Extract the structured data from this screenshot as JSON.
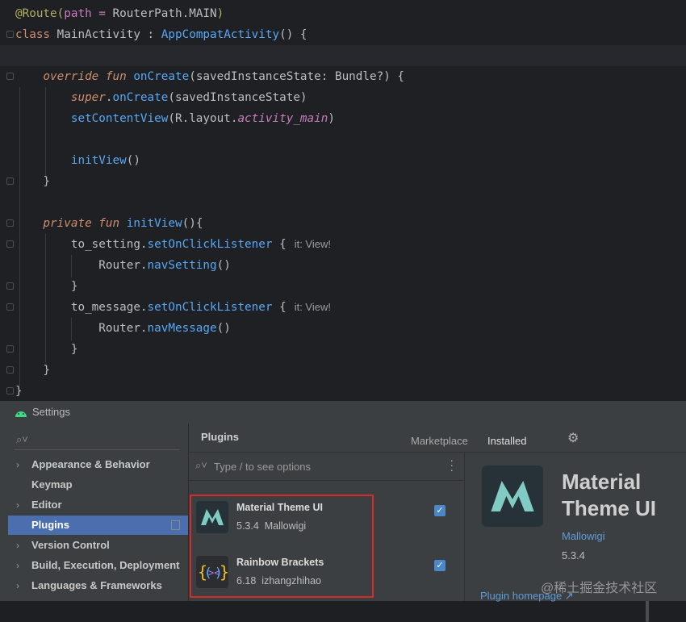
{
  "editor": {
    "lines": [
      {
        "tokens": [
          {
            "t": "@Route(",
            "c": "ann"
          },
          {
            "t": "path = ",
            "c": "str"
          },
          {
            "t": "RouterPath.",
            "c": "cls"
          },
          {
            "t": "MAIN",
            "c": "cls"
          },
          {
            "t": ")",
            "c": "ann"
          }
        ]
      },
      {
        "tokens": [
          {
            "t": "class ",
            "c": "kw"
          },
          {
            "t": "MainActivity",
            "c": "cls"
          },
          {
            "t": " : ",
            "c": "punc"
          },
          {
            "t": "AppCompatActivity",
            "c": "fn"
          },
          {
            "t": "() {",
            "c": "punc"
          }
        ]
      },
      {
        "tokens": []
      },
      {
        "tokens": [
          {
            "t": "    override fun ",
            "c": "kw it"
          },
          {
            "t": "onCreate",
            "c": "fn"
          },
          {
            "t": "(",
            "c": "punc"
          },
          {
            "t": "savedInstanceState",
            "c": "param"
          },
          {
            "t": ": Bundle?) {",
            "c": "punc"
          }
        ]
      },
      {
        "tokens": [
          {
            "t": "        super",
            "c": "kw it"
          },
          {
            "t": ".",
            "c": "punc"
          },
          {
            "t": "onCreate",
            "c": "fn"
          },
          {
            "t": "(savedInstanceState)",
            "c": "punc"
          }
        ]
      },
      {
        "tokens": [
          {
            "t": "        setContentView",
            "c": "fn"
          },
          {
            "t": "(R.layout.",
            "c": "punc"
          },
          {
            "t": "activity_main",
            "c": "prop it"
          },
          {
            "t": ")",
            "c": "punc"
          }
        ]
      },
      {
        "tokens": []
      },
      {
        "tokens": [
          {
            "t": "        initView",
            "c": "fn"
          },
          {
            "t": "()",
            "c": "punc"
          }
        ]
      },
      {
        "tokens": [
          {
            "t": "    }",
            "c": "punc"
          }
        ]
      },
      {
        "tokens": []
      },
      {
        "tokens": [
          {
            "t": "    private fun ",
            "c": "kw it"
          },
          {
            "t": "initView",
            "c": "fn"
          },
          {
            "t": "(){",
            "c": "punc"
          }
        ]
      },
      {
        "tokens": [
          {
            "t": "        to_setting.",
            "c": "punc"
          },
          {
            "t": "setOnClickListener",
            "c": "fn"
          },
          {
            "t": " {",
            "c": "punc"
          }
        ],
        "hint": "it: View!"
      },
      {
        "tokens": [
          {
            "t": "            Router.",
            "c": "punc"
          },
          {
            "t": "navSetting",
            "c": "fn"
          },
          {
            "t": "()",
            "c": "punc"
          }
        ]
      },
      {
        "tokens": [
          {
            "t": "        }",
            "c": "punc"
          }
        ]
      },
      {
        "tokens": [
          {
            "t": "        to_message.",
            "c": "punc"
          },
          {
            "t": "setOnClickListener",
            "c": "fn"
          },
          {
            "t": " {",
            "c": "punc"
          }
        ],
        "hint": "it: View!"
      },
      {
        "tokens": [
          {
            "t": "            Router.",
            "c": "punc"
          },
          {
            "t": "navMessage",
            "c": "fn"
          },
          {
            "t": "()",
            "c": "punc"
          }
        ]
      },
      {
        "tokens": [
          {
            "t": "        }",
            "c": "punc"
          }
        ]
      },
      {
        "tokens": [
          {
            "t": "    }",
            "c": "punc"
          }
        ]
      },
      {
        "tokens": [
          {
            "t": "}",
            "c": "punc"
          }
        ]
      }
    ]
  },
  "settings": {
    "title": "Settings",
    "search_placeholder": "",
    "tree": [
      {
        "label": "Appearance & Behavior",
        "arrow": true
      },
      {
        "label": "Keymap",
        "arrow": false
      },
      {
        "label": "Editor",
        "arrow": true
      },
      {
        "label": "Plugins",
        "arrow": false,
        "selected": true
      },
      {
        "label": "Version Control",
        "arrow": true
      },
      {
        "label": "Build, Execution, Deployment",
        "arrow": true
      },
      {
        "label": "Languages & Frameworks",
        "arrow": true
      }
    ],
    "plugins_title": "Plugins",
    "tabs": {
      "marketplace": "Marketplace",
      "installed": "Installed"
    },
    "list_search_placeholder": "Type / to see options",
    "plugins": [
      {
        "name": "Material Theme UI",
        "version": "5.3.4",
        "author": "Mallowigi",
        "checked": true
      },
      {
        "name": "Rainbow Brackets",
        "version": "6.18",
        "author": "izhangzhihao",
        "checked": true
      }
    ],
    "detail": {
      "name": "Material Theme UI",
      "author": "Mallowigi",
      "version": "5.3.4",
      "homepage": "Plugin homepage ↗"
    }
  },
  "watermark": "@稀土掘金技术社区",
  "colors": {
    "selection": "#4b6eaf",
    "checkbox": "#4a88c7",
    "highlight_box": "#d62b2b",
    "material_teal": "#80cbc4"
  }
}
